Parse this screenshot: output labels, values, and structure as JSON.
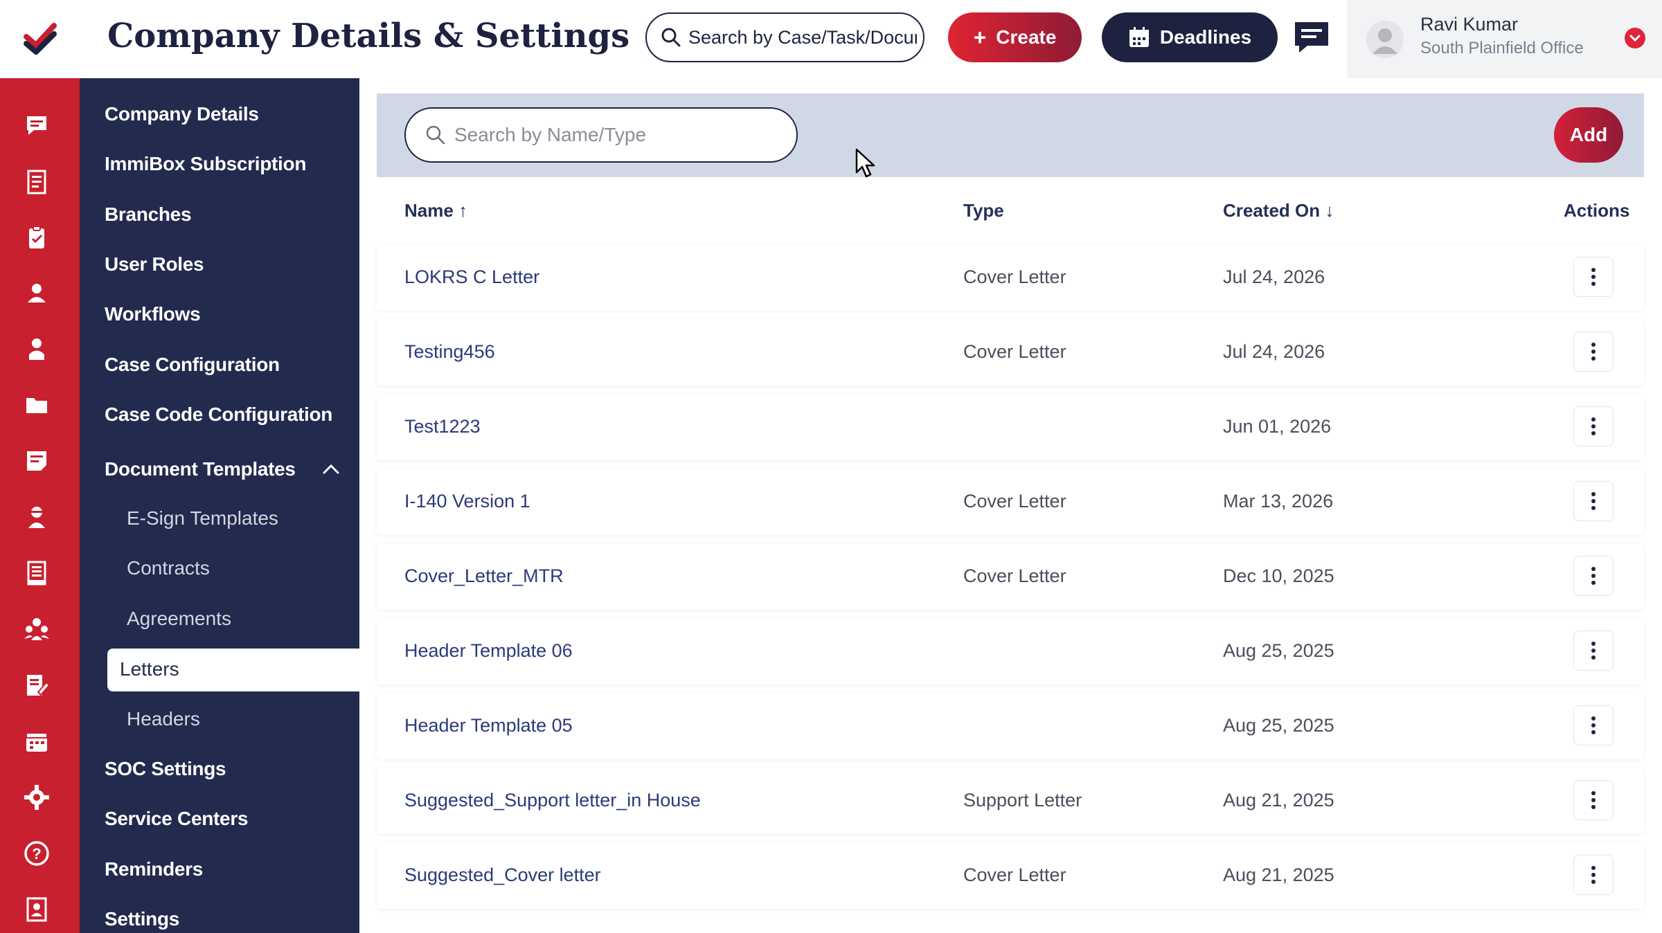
{
  "header": {
    "title": "Company Details & Settings",
    "search_placeholder": "Search by Case/Task/Document",
    "create_label": "Create",
    "deadlines_label": "Deadlines"
  },
  "user": {
    "name": "Ravi Kumar",
    "office": "South Plainfield Office"
  },
  "colors": {
    "brand_red": "#c8202f",
    "navy": "#222a4e",
    "filter_bg": "#d0d8e6"
  },
  "rail_icons": [
    "logo-check-icon",
    "chat-icon",
    "document-icon",
    "clipboard-icon",
    "contact-icon",
    "person-icon",
    "folder-icon",
    "notes-icon",
    "agent-icon",
    "report-icon",
    "team-icon",
    "edit-document-icon",
    "calendar-icon",
    "settings-icon",
    "help-icon",
    "book-icon"
  ],
  "sidebar": {
    "items": [
      {
        "label": "Company Details"
      },
      {
        "label": "ImmiBox Subscription"
      },
      {
        "label": "Branches"
      },
      {
        "label": "User Roles"
      },
      {
        "label": "Workflows"
      },
      {
        "label": "Case Configuration"
      },
      {
        "label": "Case Code Configuration"
      },
      {
        "label": "Document Templates"
      },
      {
        "label": "SOC Settings"
      },
      {
        "label": "Service Centers"
      },
      {
        "label": "Reminders"
      },
      {
        "label": "Settings"
      }
    ],
    "sub_items": [
      {
        "label": "E-Sign Templates"
      },
      {
        "label": "Contracts"
      },
      {
        "label": "Agreements"
      },
      {
        "label": "Letters"
      },
      {
        "label": "Headers"
      }
    ],
    "active": "Letters"
  },
  "filter": {
    "search_placeholder": "Search by Name/Type",
    "add_label": "Add"
  },
  "table": {
    "columns": {
      "name": "Name",
      "type": "Type",
      "created_on": "Created On",
      "actions": "Actions"
    },
    "sort": {
      "name": "ascending",
      "created_on": "descending"
    },
    "rows": [
      {
        "name": "LOKRS C Letter",
        "type": "Cover Letter",
        "created_on": "Jul 24, 2026"
      },
      {
        "name": "Testing456",
        "type": "Cover Letter",
        "created_on": "Jul 24, 2026"
      },
      {
        "name": "Test1223",
        "type": "",
        "created_on": "Jun 01, 2026"
      },
      {
        "name": "I-140 Version 1",
        "type": "Cover Letter",
        "created_on": "Mar 13, 2026"
      },
      {
        "name": "Cover_Letter_MTR",
        "type": "Cover Letter",
        "created_on": "Dec 10, 2025"
      },
      {
        "name": "Header Template 06",
        "type": "",
        "created_on": "Aug 25, 2025"
      },
      {
        "name": "Header Template 05",
        "type": "",
        "created_on": "Aug 25, 2025"
      },
      {
        "name": "Suggested_Support letter_in House",
        "type": "Support Letter",
        "created_on": "Aug 21, 2025"
      },
      {
        "name": "Suggested_Cover letter",
        "type": "Cover Letter",
        "created_on": "Aug 21, 2025"
      }
    ]
  }
}
